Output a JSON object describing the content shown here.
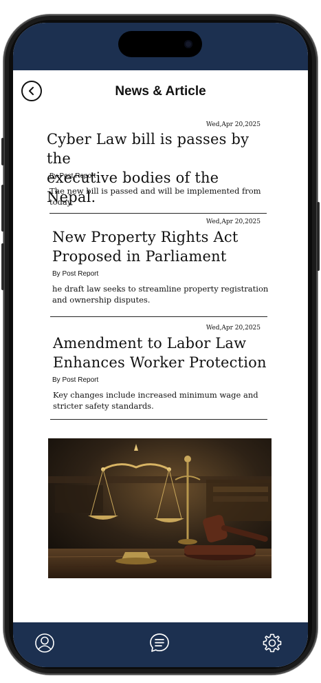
{
  "header": {
    "title": "News & Article",
    "back_icon": "chevron-left-icon"
  },
  "articles": [
    {
      "date": "Wed,Apr 20,2025",
      "headline_line1": "Cyber Law bill is passes by the",
      "headline_line2": "executive bodies of the Nepal.",
      "byline": "By Post Report",
      "summary_line1": "The new bill is passed and will be implemented from",
      "summary_line2": "today"
    },
    {
      "date": "Wed,Apr 20,2025",
      "headline_line1": "New Property Rights Act",
      "headline_line2": "Proposed in Parliament",
      "byline": "By Post Report",
      "summary_line1": "he draft law seeks to streamline property registration",
      "summary_line2": "and ownership disputes."
    },
    {
      "date": "Wed,Apr 20,2025",
      "headline_line1": "Amendment to Labor Law",
      "headline_line2": "Enhances Worker Protection",
      "byline": "By Post Report",
      "summary_line1": "Key changes include increased minimum wage and",
      "summary_line2": "stricter safety standards."
    }
  ],
  "image": {
    "subject": "scales-of-justice-and-gavel"
  },
  "nav": {
    "items": [
      {
        "icon": "profile-icon"
      },
      {
        "icon": "chat-icon"
      },
      {
        "icon": "settings-icon"
      }
    ]
  },
  "colors": {
    "bar": "#1c3050",
    "text": "#111111",
    "background": "#ffffff"
  }
}
